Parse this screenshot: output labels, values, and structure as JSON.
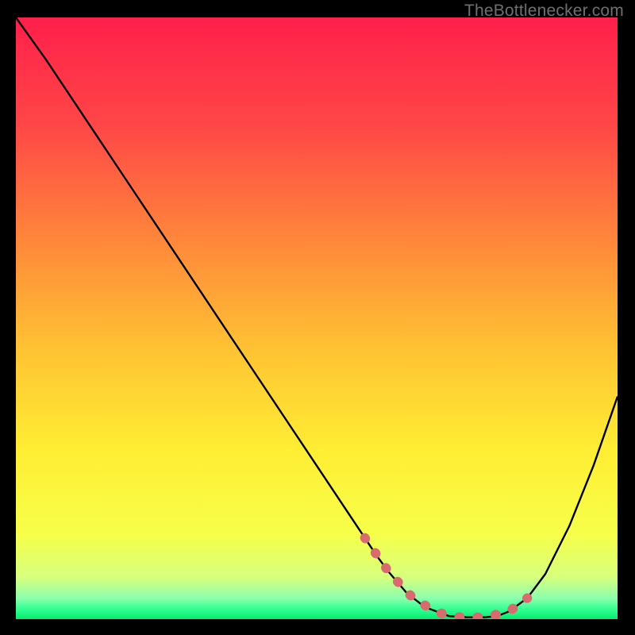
{
  "attribution": "TheBottlenecker.com",
  "chart_data": {
    "type": "line",
    "title": "",
    "xlabel": "",
    "ylabel": "",
    "xlim": [
      0,
      100
    ],
    "ylim": [
      0,
      100
    ],
    "series": [
      {
        "name": "curve",
        "x": [
          0,
          5,
          10,
          15,
          20,
          25,
          30,
          35,
          40,
          45,
          50,
          55,
          58,
          60,
          62,
          65,
          68,
          72,
          75,
          78,
          80,
          82,
          85,
          88,
          92,
          96,
          100
        ],
        "y": [
          100,
          93,
          85.5,
          78,
          70.5,
          63,
          55.5,
          48,
          40.5,
          33,
          25.5,
          18,
          13.5,
          10.5,
          7.8,
          4.3,
          2.0,
          0.5,
          0.3,
          0.3,
          0.5,
          1.3,
          3.5,
          7.5,
          15.5,
          25.5,
          37
        ]
      },
      {
        "name": "highlight-segment",
        "x": [
          58,
          62,
          66,
          70,
          74,
          78,
          82,
          85
        ],
        "y": [
          13.5,
          7.8,
          3.5,
          1.1,
          0.3,
          0.3,
          1.3,
          3.5
        ]
      }
    ],
    "gradient_stops": [
      {
        "offset": 0.0,
        "color": "#ff1f4b"
      },
      {
        "offset": 0.18,
        "color": "#ff4747"
      },
      {
        "offset": 0.38,
        "color": "#ff8a3a"
      },
      {
        "offset": 0.55,
        "color": "#ffc233"
      },
      {
        "offset": 0.72,
        "color": "#ffee33"
      },
      {
        "offset": 0.86,
        "color": "#f6ff4a"
      },
      {
        "offset": 0.93,
        "color": "#d7ff7d"
      },
      {
        "offset": 0.965,
        "color": "#8cffad"
      },
      {
        "offset": 0.985,
        "color": "#2bff8f"
      },
      {
        "offset": 1.0,
        "color": "#09e86f"
      }
    ],
    "highlight_style": {
      "stroke": "#d86b6d",
      "stroke_width": 12,
      "dash": "1 22",
      "linecap": "round"
    },
    "curve_style": {
      "stroke": "#000000",
      "stroke_width": 2.4
    }
  }
}
